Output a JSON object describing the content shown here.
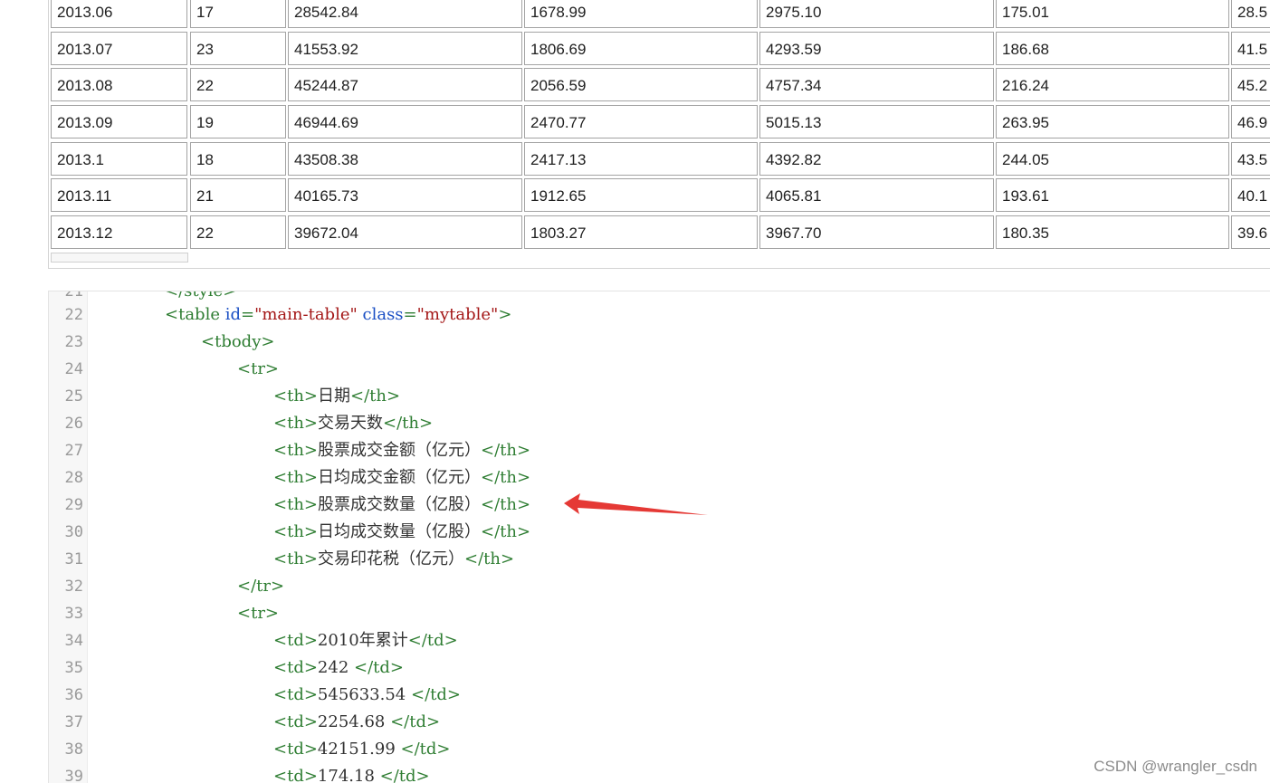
{
  "table_preview": {
    "rows": [
      [
        "2013.06",
        "17",
        "28542.84",
        "1678.99",
        "2975.10",
        "175.01",
        "28.5"
      ],
      [
        "2013.07",
        "23",
        "41553.92",
        "1806.69",
        "4293.59",
        "186.68",
        "41.5"
      ],
      [
        "2013.08",
        "22",
        "45244.87",
        "2056.59",
        "4757.34",
        "216.24",
        "45.2"
      ],
      [
        "2013.09",
        "19",
        "46944.69",
        "2470.77",
        "5015.13",
        "263.95",
        "46.9"
      ],
      [
        "2013.1",
        "18",
        "43508.38",
        "2417.13",
        "4392.82",
        "244.05",
        "43.5"
      ],
      [
        "2013.11",
        "21",
        "40165.73",
        "1912.65",
        "4065.81",
        "193.61",
        "40.1"
      ],
      [
        "2013.12",
        "22",
        "39672.04",
        "1803.27",
        "3967.70",
        "180.35",
        "39.6"
      ]
    ]
  },
  "code_editor": {
    "partial_top_line_text": "</style>",
    "lines": [
      {
        "num": "22",
        "indent": 0,
        "tokens": [
          {
            "t": "tag",
            "v": "<table "
          },
          {
            "t": "attr",
            "v": "id"
          },
          {
            "t": "punct",
            "v": "="
          },
          {
            "t": "val",
            "v": "\"main-table\""
          },
          {
            "t": "plain",
            "v": " "
          },
          {
            "t": "attr",
            "v": "class"
          },
          {
            "t": "punct",
            "v": "="
          },
          {
            "t": "val",
            "v": "\"mytable\""
          },
          {
            "t": "tag",
            "v": ">"
          }
        ]
      },
      {
        "num": "23",
        "indent": 1,
        "tokens": [
          {
            "t": "tag",
            "v": "<tbody>"
          }
        ]
      },
      {
        "num": "24",
        "indent": 2,
        "tokens": [
          {
            "t": "tag",
            "v": "<tr>"
          }
        ]
      },
      {
        "num": "25",
        "indent": 3,
        "tokens": [
          {
            "t": "tag",
            "v": "<th>"
          },
          {
            "t": "plain",
            "v": "日期"
          },
          {
            "t": "tag",
            "v": "</th>"
          }
        ]
      },
      {
        "num": "26",
        "indent": 3,
        "tokens": [
          {
            "t": "tag",
            "v": "<th>"
          },
          {
            "t": "plain",
            "v": "交易天数"
          },
          {
            "t": "tag",
            "v": "</th>"
          }
        ]
      },
      {
        "num": "27",
        "indent": 3,
        "tokens": [
          {
            "t": "tag",
            "v": "<th>"
          },
          {
            "t": "plain",
            "v": "股票成交金额（亿元）"
          },
          {
            "t": "tag",
            "v": "</th>"
          }
        ]
      },
      {
        "num": "28",
        "indent": 3,
        "tokens": [
          {
            "t": "tag",
            "v": "<th>"
          },
          {
            "t": "plain",
            "v": "日均成交金额（亿元）"
          },
          {
            "t": "tag",
            "v": "</th>"
          }
        ]
      },
      {
        "num": "29",
        "indent": 3,
        "tokens": [
          {
            "t": "tag",
            "v": "<th>"
          },
          {
            "t": "plain",
            "v": "股票成交数量（亿股）"
          },
          {
            "t": "tag",
            "v": "</th>"
          }
        ]
      },
      {
        "num": "30",
        "indent": 3,
        "tokens": [
          {
            "t": "tag",
            "v": "<th>"
          },
          {
            "t": "plain",
            "v": "日均成交数量（亿股）"
          },
          {
            "t": "tag",
            "v": "</th>"
          }
        ]
      },
      {
        "num": "31",
        "indent": 3,
        "tokens": [
          {
            "t": "tag",
            "v": "<th>"
          },
          {
            "t": "plain",
            "v": "交易印花税（亿元）"
          },
          {
            "t": "tag",
            "v": "</th>"
          }
        ]
      },
      {
        "num": "32",
        "indent": 2,
        "tokens": [
          {
            "t": "tag",
            "v": "</tr>"
          }
        ]
      },
      {
        "num": "33",
        "indent": 2,
        "tokens": [
          {
            "t": "tag",
            "v": "<tr>"
          }
        ]
      },
      {
        "num": "34",
        "indent": 3,
        "tokens": [
          {
            "t": "tag",
            "v": "<td>"
          },
          {
            "t": "plain",
            "v": "2010年累计"
          },
          {
            "t": "tag",
            "v": "</td>"
          }
        ]
      },
      {
        "num": "35",
        "indent": 3,
        "tokens": [
          {
            "t": "tag",
            "v": "<td>"
          },
          {
            "t": "plain",
            "v": "242 "
          },
          {
            "t": "tag",
            "v": "</td>"
          }
        ]
      },
      {
        "num": "36",
        "indent": 3,
        "tokens": [
          {
            "t": "tag",
            "v": "<td>"
          },
          {
            "t": "plain",
            "v": "545633.54 "
          },
          {
            "t": "tag",
            "v": "</td>"
          }
        ]
      },
      {
        "num": "37",
        "indent": 3,
        "tokens": [
          {
            "t": "tag",
            "v": "<td>"
          },
          {
            "t": "plain",
            "v": "2254.68 "
          },
          {
            "t": "tag",
            "v": "</td>"
          }
        ]
      },
      {
        "num": "38",
        "indent": 3,
        "tokens": [
          {
            "t": "tag",
            "v": "<td>"
          },
          {
            "t": "plain",
            "v": "42151.99 "
          },
          {
            "t": "tag",
            "v": "</td>"
          }
        ]
      },
      {
        "num": "39",
        "indent": 3,
        "tokens": [
          {
            "t": "tag",
            "v": "<td>"
          },
          {
            "t": "plain",
            "v": "174.18 "
          },
          {
            "t": "tag",
            "v": "</td>"
          }
        ]
      }
    ]
  },
  "annotation": {
    "arrow_color": "#e53935"
  },
  "watermark": {
    "text": "CSDN @wrangler_csdn"
  }
}
